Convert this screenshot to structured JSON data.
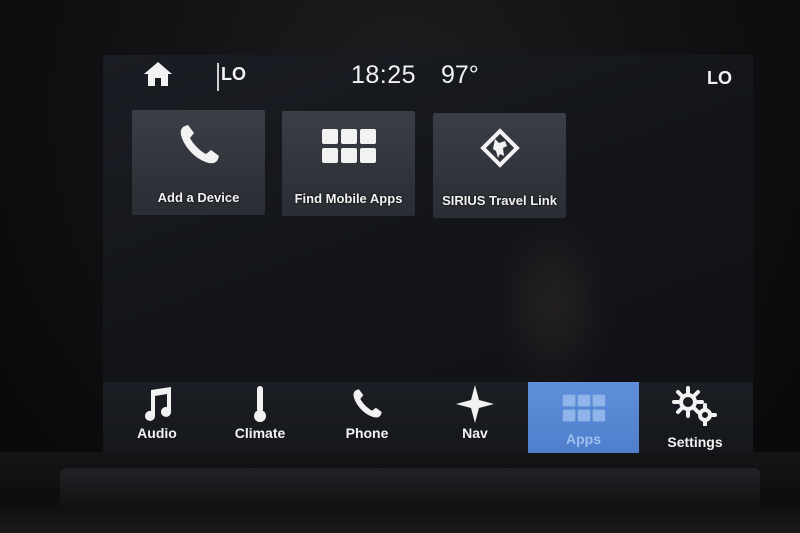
{
  "status_bar": {
    "climate_left": "LO",
    "time": "18:25",
    "outside_temp": "97°",
    "climate_right": "LO"
  },
  "apps": [
    {
      "label": "Add a Device",
      "icon": "phone-icon"
    },
    {
      "label": "Find Mobile Apps",
      "icon": "grid-icon"
    },
    {
      "label": "SIRIUS Travel Link",
      "icon": "sirius-dog-icon"
    }
  ],
  "nav": [
    {
      "label": "Audio",
      "icon": "music-note-icon"
    },
    {
      "label": "Climate",
      "icon": "thermometer-icon"
    },
    {
      "label": "Phone",
      "icon": "phone-icon"
    },
    {
      "label": "Nav",
      "icon": "compass-star-icon"
    },
    {
      "label": "Apps",
      "icon": "grid-icon",
      "active": true
    },
    {
      "label": "Settings",
      "icon": "gears-icon"
    }
  ],
  "colors": {
    "active_tab": "#5a8ad6",
    "tile": "#33373e",
    "screen_bg": "#15171c"
  }
}
